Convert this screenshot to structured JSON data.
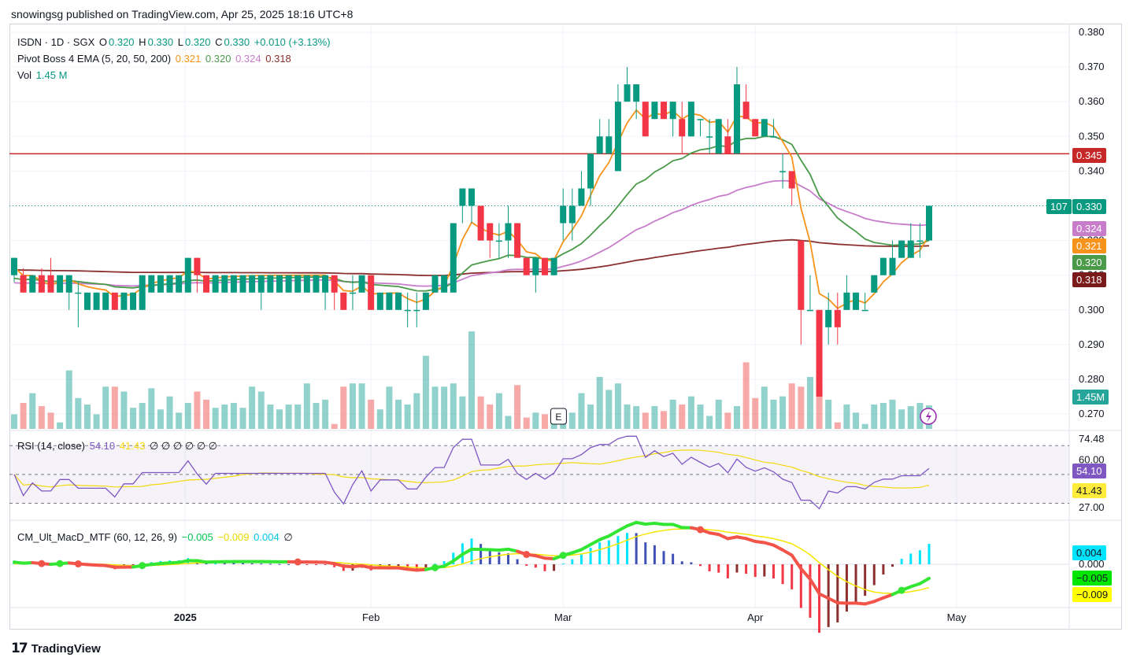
{
  "header": {
    "text": "snowingsg published on TradingView.com, Apr 25, 2025 18:16 UTC+8"
  },
  "legend": {
    "symbol": "ISDN · 1D · SGX",
    "o_label": "O",
    "o_val": "0.320",
    "h_label": "H",
    "h_val": "0.330",
    "l_label": "L",
    "l_val": "0.320",
    "c_label": "C",
    "c_val": "0.330",
    "change": "+0.010 (+3.13%)",
    "ema_label": "Pivot Boss 4 EMA (5, 20, 50, 200)",
    "ema5": "0.321",
    "ema20": "0.320",
    "ema50": "0.324",
    "ema200": "0.318",
    "vol_label": "Vol",
    "vol_val": "1.45 M",
    "rsi_label": "RSI (14, close)",
    "rsi_val": "54.10",
    "rsi_ma": "41.43",
    "rsi_extra": "∅ ∅ ∅ ∅ ∅ ∅",
    "macd_label": "CM_Ult_MacD_MTF (60, 12, 26, 9)",
    "macd_val": "−0.005",
    "macd_signal": "−0.009",
    "macd_hist": "0.004",
    "macd_extra": "∅"
  },
  "price_axis": [
    "0.380",
    "0.370",
    "0.360",
    "0.350",
    "0.340",
    "0.330",
    "0.320",
    "0.310",
    "0.300",
    "0.290",
    "0.280",
    "0.270"
  ],
  "price_tags": {
    "resistance": "0.345",
    "last": "0.330",
    "countdown": "107",
    "ema50": "0.324",
    "ema5": "0.321",
    "ema20": "0.320",
    "ema200": "0.318",
    "volume": "1.45M"
  },
  "rsi_axis": {
    "top": "74.48",
    "mid": "60.00",
    "bottom": "27.00",
    "rsi": "54.10",
    "ma": "41.43"
  },
  "macd_axis": {
    "hist": "0.004",
    "zero": "0.000",
    "macd": "−0.005",
    "signal": "−0.009"
  },
  "time_axis": [
    "2025",
    "Feb",
    "Mar",
    "Apr",
    "May"
  ],
  "earnings_marker": "E",
  "brand": "TradingView",
  "colors": {
    "up": "#089981",
    "down": "#f23645",
    "ema5": "#f7931a",
    "ema20": "#4a9a4a",
    "ema50": "#c77dca",
    "ema200": "#8b2f2f",
    "resistance": "#c62828",
    "rsi": "#7e57c2"
  },
  "chart_data": {
    "type": "candlestick",
    "resistance_level": 0.345,
    "ylim": [
      0.265,
      0.382
    ],
    "candles": [
      {
        "o": 0.31,
        "h": 0.315,
        "l": 0.308,
        "c": 0.315
      },
      {
        "o": 0.31,
        "h": 0.312,
        "l": 0.305,
        "c": 0.305
      },
      {
        "o": 0.305,
        "h": 0.31,
        "l": 0.305,
        "c": 0.31
      },
      {
        "o": 0.31,
        "h": 0.312,
        "l": 0.305,
        "c": 0.305
      },
      {
        "o": 0.31,
        "h": 0.315,
        "l": 0.305,
        "c": 0.305
      },
      {
        "o": 0.305,
        "h": 0.31,
        "l": 0.305,
        "c": 0.31
      },
      {
        "o": 0.305,
        "h": 0.31,
        "l": 0.3,
        "c": 0.31
      },
      {
        "o": 0.305,
        "h": 0.308,
        "l": 0.295,
        "c": 0.305
      },
      {
        "o": 0.3,
        "h": 0.305,
        "l": 0.3,
        "c": 0.305
      },
      {
        "o": 0.3,
        "h": 0.305,
        "l": 0.3,
        "c": 0.305
      },
      {
        "o": 0.3,
        "h": 0.305,
        "l": 0.3,
        "c": 0.305
      },
      {
        "o": 0.305,
        "h": 0.305,
        "l": 0.3,
        "c": 0.3
      },
      {
        "o": 0.3,
        "h": 0.305,
        "l": 0.3,
        "c": 0.305
      },
      {
        "o": 0.3,
        "h": 0.305,
        "l": 0.3,
        "c": 0.305
      },
      {
        "o": 0.3,
        "h": 0.31,
        "l": 0.3,
        "c": 0.31
      },
      {
        "o": 0.305,
        "h": 0.31,
        "l": 0.305,
        "c": 0.31
      },
      {
        "o": 0.305,
        "h": 0.31,
        "l": 0.305,
        "c": 0.31
      },
      {
        "o": 0.305,
        "h": 0.31,
        "l": 0.305,
        "c": 0.31
      },
      {
        "o": 0.305,
        "h": 0.31,
        "l": 0.305,
        "c": 0.31
      },
      {
        "o": 0.305,
        "h": 0.315,
        "l": 0.305,
        "c": 0.315
      },
      {
        "o": 0.315,
        "h": 0.315,
        "l": 0.305,
        "c": 0.31
      },
      {
        "o": 0.31,
        "h": 0.31,
        "l": 0.305,
        "c": 0.305
      },
      {
        "o": 0.305,
        "h": 0.31,
        "l": 0.305,
        "c": 0.31
      },
      {
        "o": 0.305,
        "h": 0.31,
        "l": 0.305,
        "c": 0.31
      },
      {
        "o": 0.305,
        "h": 0.31,
        "l": 0.305,
        "c": 0.31
      },
      {
        "o": 0.305,
        "h": 0.31,
        "l": 0.305,
        "c": 0.31
      },
      {
        "o": 0.305,
        "h": 0.31,
        "l": 0.305,
        "c": 0.31
      },
      {
        "o": 0.305,
        "h": 0.31,
        "l": 0.3,
        "c": 0.31
      },
      {
        "o": 0.305,
        "h": 0.31,
        "l": 0.305,
        "c": 0.31
      },
      {
        "o": 0.305,
        "h": 0.31,
        "l": 0.305,
        "c": 0.31
      },
      {
        "o": 0.305,
        "h": 0.31,
        "l": 0.305,
        "c": 0.31
      },
      {
        "o": 0.305,
        "h": 0.31,
        "l": 0.305,
        "c": 0.31
      },
      {
        "o": 0.305,
        "h": 0.31,
        "l": 0.305,
        "c": 0.31
      },
      {
        "o": 0.305,
        "h": 0.31,
        "l": 0.305,
        "c": 0.31
      },
      {
        "o": 0.305,
        "h": 0.31,
        "l": 0.3,
        "c": 0.31
      },
      {
        "o": 0.31,
        "h": 0.31,
        "l": 0.3,
        "c": 0.305
      },
      {
        "o": 0.305,
        "h": 0.305,
        "l": 0.3,
        "c": 0.3
      },
      {
        "o": 0.305,
        "h": 0.31,
        "l": 0.3,
        "c": 0.305
      },
      {
        "o": 0.305,
        "h": 0.31,
        "l": 0.305,
        "c": 0.31
      },
      {
        "o": 0.31,
        "h": 0.31,
        "l": 0.3,
        "c": 0.3
      },
      {
        "o": 0.3,
        "h": 0.305,
        "l": 0.3,
        "c": 0.305
      },
      {
        "o": 0.3,
        "h": 0.305,
        "l": 0.3,
        "c": 0.305
      },
      {
        "o": 0.3,
        "h": 0.305,
        "l": 0.3,
        "c": 0.305
      },
      {
        "o": 0.3,
        "h": 0.305,
        "l": 0.295,
        "c": 0.3
      },
      {
        "o": 0.3,
        "h": 0.305,
        "l": 0.295,
        "c": 0.3
      },
      {
        "o": 0.3,
        "h": 0.305,
        "l": 0.3,
        "c": 0.305
      },
      {
        "o": 0.305,
        "h": 0.31,
        "l": 0.305,
        "c": 0.31
      },
      {
        "o": 0.305,
        "h": 0.31,
        "l": 0.305,
        "c": 0.31
      },
      {
        "o": 0.305,
        "h": 0.325,
        "l": 0.305,
        "c": 0.325
      },
      {
        "o": 0.33,
        "h": 0.335,
        "l": 0.325,
        "c": 0.335
      },
      {
        "o": 0.33,
        "h": 0.335,
        "l": 0.325,
        "c": 0.335
      },
      {
        "o": 0.33,
        "h": 0.33,
        "l": 0.32,
        "c": 0.32
      },
      {
        "o": 0.325,
        "h": 0.325,
        "l": 0.315,
        "c": 0.32
      },
      {
        "o": 0.32,
        "h": 0.325,
        "l": 0.315,
        "c": 0.32
      },
      {
        "o": 0.32,
        "h": 0.33,
        "l": 0.315,
        "c": 0.325
      },
      {
        "o": 0.325,
        "h": 0.325,
        "l": 0.315,
        "c": 0.315
      },
      {
        "o": 0.315,
        "h": 0.315,
        "l": 0.31,
        "c": 0.31
      },
      {
        "o": 0.31,
        "h": 0.315,
        "l": 0.305,
        "c": 0.315
      },
      {
        "o": 0.315,
        "h": 0.315,
        "l": 0.31,
        "c": 0.31
      },
      {
        "o": 0.31,
        "h": 0.315,
        "l": 0.31,
        "c": 0.315
      },
      {
        "o": 0.325,
        "h": 0.335,
        "l": 0.32,
        "c": 0.33
      },
      {
        "o": 0.325,
        "h": 0.335,
        "l": 0.32,
        "c": 0.33
      },
      {
        "o": 0.33,
        "h": 0.34,
        "l": 0.33,
        "c": 0.335
      },
      {
        "o": 0.335,
        "h": 0.345,
        "l": 0.33,
        "c": 0.345
      },
      {
        "o": 0.345,
        "h": 0.355,
        "l": 0.345,
        "c": 0.35
      },
      {
        "o": 0.345,
        "h": 0.355,
        "l": 0.345,
        "c": 0.35
      },
      {
        "o": 0.34,
        "h": 0.365,
        "l": 0.34,
        "c": 0.36
      },
      {
        "o": 0.36,
        "h": 0.37,
        "l": 0.36,
        "c": 0.365
      },
      {
        "o": 0.36,
        "h": 0.365,
        "l": 0.355,
        "c": 0.365
      },
      {
        "o": 0.36,
        "h": 0.36,
        "l": 0.35,
        "c": 0.35
      },
      {
        "o": 0.355,
        "h": 0.36,
        "l": 0.355,
        "c": 0.36
      },
      {
        "o": 0.36,
        "h": 0.36,
        "l": 0.355,
        "c": 0.355
      },
      {
        "o": 0.355,
        "h": 0.36,
        "l": 0.35,
        "c": 0.36
      },
      {
        "o": 0.355,
        "h": 0.36,
        "l": 0.345,
        "c": 0.35
      },
      {
        "o": 0.35,
        "h": 0.36,
        "l": 0.35,
        "c": 0.36
      },
      {
        "o": 0.355,
        "h": 0.355,
        "l": 0.35,
        "c": 0.355
      },
      {
        "o": 0.35,
        "h": 0.355,
        "l": 0.345,
        "c": 0.35
      },
      {
        "o": 0.345,
        "h": 0.355,
        "l": 0.345,
        "c": 0.355
      },
      {
        "o": 0.35,
        "h": 0.355,
        "l": 0.345,
        "c": 0.345
      },
      {
        "o": 0.345,
        "h": 0.37,
        "l": 0.345,
        "c": 0.365
      },
      {
        "o": 0.36,
        "h": 0.365,
        "l": 0.355,
        "c": 0.355
      },
      {
        "o": 0.355,
        "h": 0.355,
        "l": 0.35,
        "c": 0.35
      },
      {
        "o": 0.35,
        "h": 0.355,
        "l": 0.35,
        "c": 0.355
      },
      {
        "o": 0.35,
        "h": 0.355,
        "l": 0.35,
        "c": 0.35
      },
      {
        "o": 0.34,
        "h": 0.345,
        "l": 0.335,
        "c": 0.34
      },
      {
        "o": 0.34,
        "h": 0.34,
        "l": 0.33,
        "c": 0.335
      },
      {
        "o": 0.32,
        "h": 0.32,
        "l": 0.29,
        "c": 0.3
      },
      {
        "o": 0.3,
        "h": 0.31,
        "l": 0.3,
        "c": 0.3
      },
      {
        "o": 0.3,
        "h": 0.3,
        "l": 0.275,
        "c": 0.275
      },
      {
        "o": 0.295,
        "h": 0.305,
        "l": 0.29,
        "c": 0.3
      },
      {
        "o": 0.3,
        "h": 0.305,
        "l": 0.29,
        "c": 0.295
      },
      {
        "o": 0.3,
        "h": 0.31,
        "l": 0.3,
        "c": 0.305
      },
      {
        "o": 0.3,
        "h": 0.305,
        "l": 0.3,
        "c": 0.305
      },
      {
        "o": 0.3,
        "h": 0.305,
        "l": 0.3,
        "c": 0.3
      },
      {
        "o": 0.305,
        "h": 0.31,
        "l": 0.305,
        "c": 0.31
      },
      {
        "o": 0.31,
        "h": 0.315,
        "l": 0.31,
        "c": 0.315
      },
      {
        "o": 0.31,
        "h": 0.32,
        "l": 0.31,
        "c": 0.315
      },
      {
        "o": 0.315,
        "h": 0.32,
        "l": 0.315,
        "c": 0.32
      },
      {
        "o": 0.315,
        "h": 0.325,
        "l": 0.315,
        "c": 0.32
      },
      {
        "o": 0.32,
        "h": 0.325,
        "l": 0.315,
        "c": 0.32
      },
      {
        "o": 0.32,
        "h": 0.33,
        "l": 0.32,
        "c": 0.33
      }
    ],
    "volume": [
      0.9,
      1.6,
      2.2,
      1.4,
      1.0,
      0.4,
      3.6,
      1.9,
      1.5,
      0.9,
      2.6,
      2.6,
      2.3,
      1.3,
      1.6,
      2.5,
      1.2,
      2.0,
      1.0,
      1.6,
      2.3,
      1.8,
      1.3,
      1.5,
      1.6,
      1.3,
      2.6,
      2.3,
      1.5,
      1.2,
      1.5,
      1.5,
      2.8,
      1.6,
      1.8,
      0.3,
      2.6,
      2.8,
      2.8,
      1.8,
      1.2,
      2.6,
      1.8,
      1.5,
      2.2,
      4.5,
      2.6,
      2.6,
      2.8,
      2.0,
      6.0,
      2.0,
      1.5,
      2.2,
      0.8,
      2.7,
      0.7,
      1.0,
      0.9,
      0.8,
      1.0,
      1.0,
      2.2,
      1.5,
      3.2,
      2.4,
      2.8,
      1.5,
      1.4,
      1.0,
      1.4,
      1.1,
      1.8,
      1.5,
      2.0,
      1.5,
      0.8,
      1.8,
      1.0,
      1.4,
      4.1,
      1.9,
      2.6,
      1.8,
      2.0,
      2.8,
      2.6,
      3.2,
      2.6,
      1.8,
      0.4,
      1.5,
      1.0,
      0.3,
      1.5,
      1.6,
      1.8,
      1.2,
      1.4,
      1.6,
      1.45
    ]
  }
}
